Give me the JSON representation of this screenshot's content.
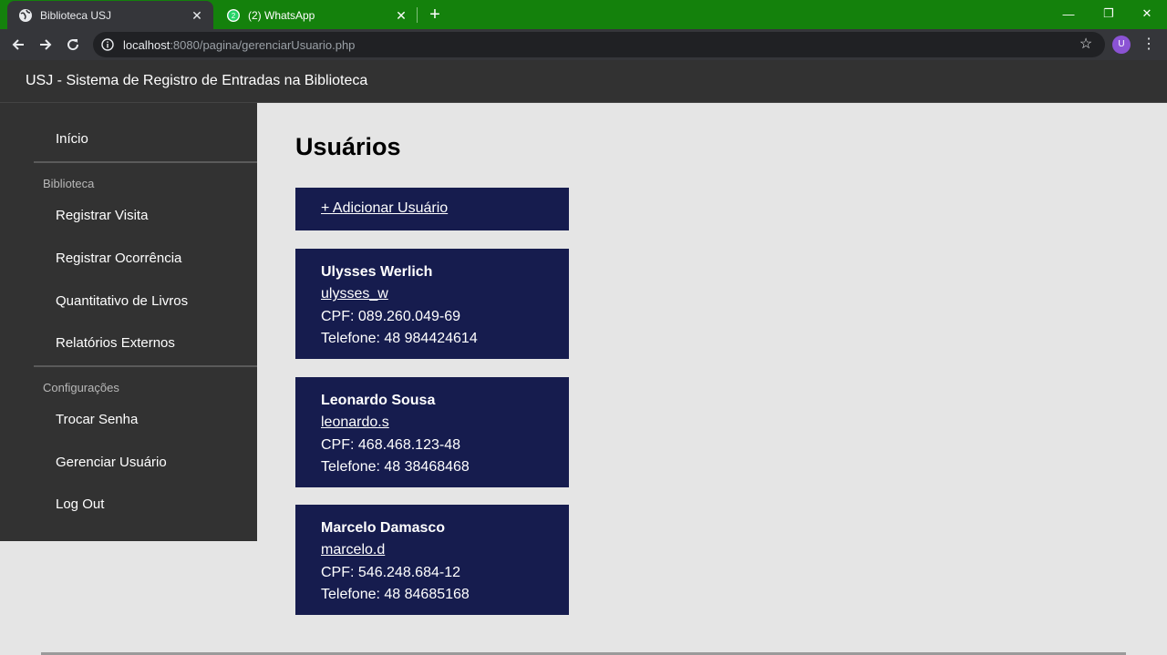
{
  "browser": {
    "tabs": [
      {
        "title": "Biblioteca USJ",
        "icon": "globe-icon",
        "active": true
      },
      {
        "title": "(2) WhatsApp",
        "icon": "whatsapp-icon",
        "active": false
      }
    ],
    "url_host": "localhost",
    "url_path": ":8080/pagina/gerenciarUsuario.php",
    "profile_initial": "U",
    "colors": {
      "tabstrip": "#14810c",
      "toolbar": "#35363a"
    }
  },
  "app": {
    "title": "USJ - Sistema de Registro de Entradas na Biblioteca"
  },
  "sidebar": {
    "home": "Início",
    "section_library": "Biblioteca",
    "library_items": [
      "Registrar Visita",
      "Registrar Ocorrência",
      "Quantitativo de Livros",
      "Relatórios Externos"
    ],
    "section_settings": "Configurações",
    "settings_items": [
      "Trocar Senha",
      "Gerenciar Usuário",
      "Log Out"
    ]
  },
  "main": {
    "title": "Usuários",
    "add_label": "+ Adicionar Usuário",
    "users": [
      {
        "name": "Ulysses Werlich",
        "login": "ulysses_w",
        "cpf": "CPF: 089.260.049-69",
        "phone": "Telefone: 48 984424614"
      },
      {
        "name": "Leonardo Sousa",
        "login": "leonardo.s",
        "cpf": "CPF: 468.468.123-48",
        "phone": "Telefone: 48 38468468"
      },
      {
        "name": "Marcelo Damasco",
        "login": "marcelo.d",
        "cpf": "CPF: 546.248.684-12",
        "phone": "Telefone: 48 84685168"
      }
    ],
    "card_color": "#161c4e"
  }
}
